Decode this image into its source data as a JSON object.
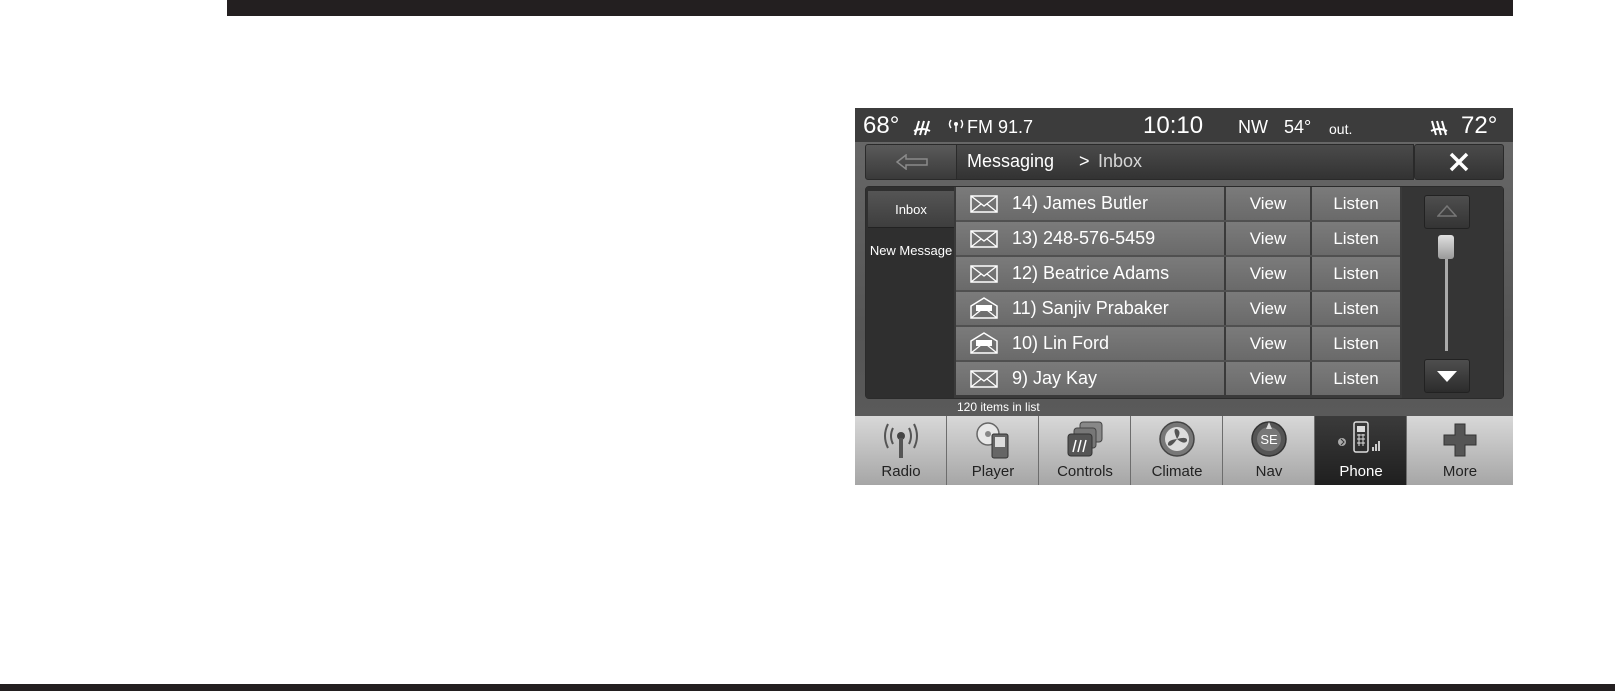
{
  "status_bar": {
    "driver_temp": "68°",
    "radio_station": "FM 91.7",
    "clock": "10:10",
    "compass": "NW",
    "outside_temp": "54°",
    "outside_label": "out.",
    "passenger_temp": "72°"
  },
  "nav": {
    "section": "Messaging",
    "separator": ">",
    "page": "Inbox"
  },
  "side_menu": {
    "inbox": "Inbox",
    "new_message": "New Message"
  },
  "messages": [
    {
      "name": "14) James Butler",
      "view": "View",
      "listen": "Listen",
      "icon": "envelope-closed-icon"
    },
    {
      "name": "13) 248-576-5459",
      "view": "View",
      "listen": "Listen",
      "icon": "envelope-closed-icon"
    },
    {
      "name": "12) Beatrice Adams",
      "view": "View",
      "listen": "Listen",
      "icon": "envelope-closed-icon"
    },
    {
      "name": "11) Sanjiv Prabaker",
      "view": "View",
      "listen": "Listen",
      "icon": "envelope-open-icon"
    },
    {
      "name": "10) Lin Ford",
      "view": "View",
      "listen": "Listen",
      "icon": "envelope-open-icon"
    },
    {
      "name": "9) Jay Kay",
      "view": "View",
      "listen": "Listen",
      "icon": "envelope-closed-icon"
    }
  ],
  "list_count": "120 items in list",
  "apps": {
    "radio": "Radio",
    "player": "Player",
    "controls": "Controls",
    "climate": "Climate",
    "nav": "Nav",
    "nav_compass": "SE",
    "phone": "Phone",
    "more": "More"
  },
  "colors": {
    "screen_bg": "#5e5e5e",
    "row_bg": "#747474",
    "active_app_bg": "#2a2a2a",
    "app_bg": "#c4c4c4"
  }
}
